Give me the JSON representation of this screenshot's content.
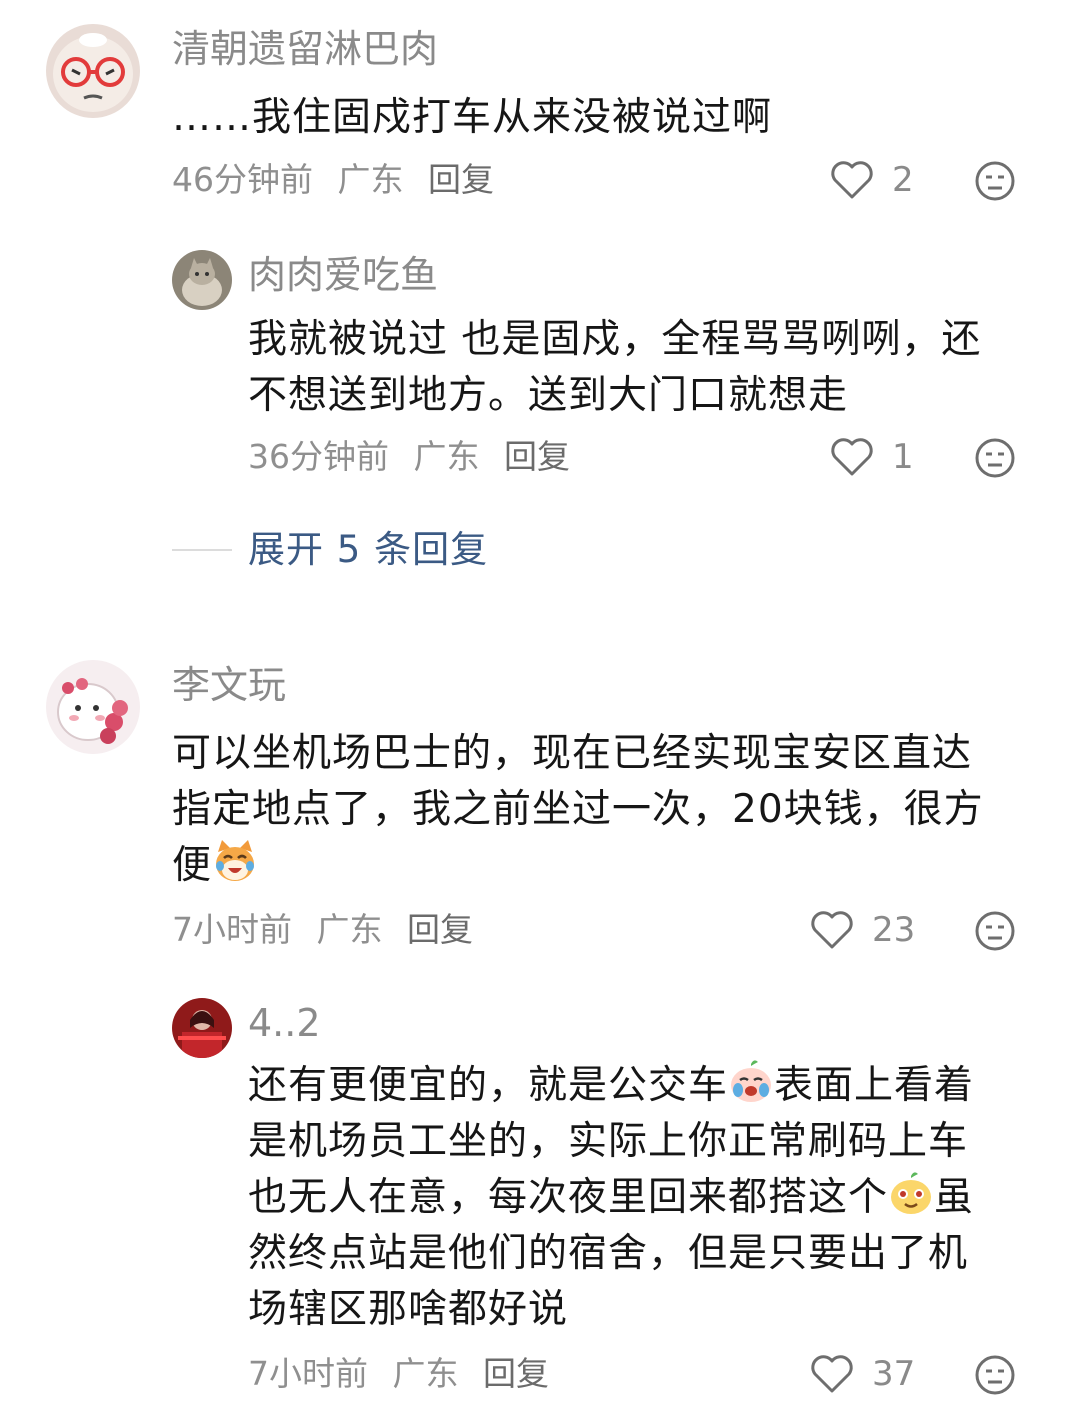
{
  "comments": [
    {
      "username": "清朝遗留淋巴肉",
      "content_lines": [
        "……我住固戍打车从来没被说过啊"
      ],
      "time": "46分钟前",
      "location": "广东",
      "reply_label": "回复",
      "likes": "2",
      "replies": [
        {
          "username": "肉肉爱吃鱼",
          "content_lines": [
            "我就被说过 也是固戍，全程骂骂咧咧，还",
            "不想送到地方。送到大门口就想走"
          ],
          "time": "36分钟前",
          "location": "广东",
          "reply_label": "回复",
          "likes": "1"
        }
      ],
      "expand_label": "展开 5 条回复"
    },
    {
      "username": "李文玩",
      "content_lines": [
        "可以坐机场巴士的，现在已经实现宝安区直达",
        "指定地点了，我之前坐过一次，20块钱，很方",
        "便"
      ],
      "time": "7小时前",
      "location": "广东",
      "reply_label": "回复",
      "likes": "23",
      "replies": [
        {
          "username": "4..2",
          "content_lines": [
            "还有更便宜的，就是公交车",
            "表面上看着",
            "是机场员工坐的，实际上你正常刷码上车",
            "也无人在意，每次夜里回来都搭这个",
            "虽",
            "然终点站是他们的宿舍，但是只要出了机",
            "场辖区那啥都好说"
          ],
          "time": "7小时前",
          "location": "广东",
          "reply_label": "回复",
          "likes": "37"
        }
      ]
    }
  ],
  "icons": {
    "like": "heart-outline-icon",
    "dislike": "meh-face-icon",
    "emoji_1": "laughing-cat-emoji",
    "emoji_2": "crying-bun-emoji",
    "emoji_3": "smiling-bun-emoji"
  },
  "colors": {
    "username": "#8a8a8a",
    "text": "#161616",
    "meta": "#8f8f8f",
    "expand": "#3b5a84"
  }
}
